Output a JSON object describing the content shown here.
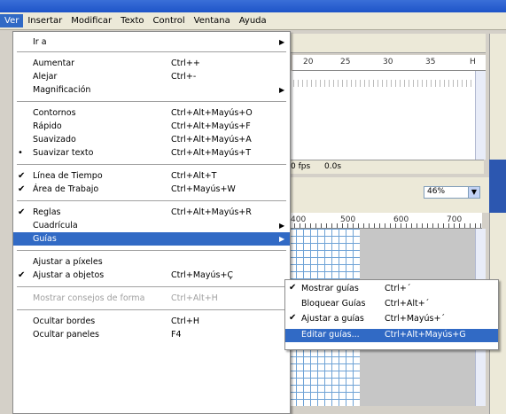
{
  "menubar": {
    "items": [
      "Ver",
      "Insertar",
      "Modificar",
      "Texto",
      "Control",
      "Ventana",
      "Ayuda"
    ]
  },
  "menu": {
    "go_to": {
      "label": "Ir a"
    },
    "zoom_in": {
      "label": "Aumentar",
      "shortcut": "Ctrl++"
    },
    "zoom_out": {
      "label": "Alejar",
      "shortcut": "Ctrl+-"
    },
    "magnification": {
      "label": "Magnificación"
    },
    "outlines": {
      "label": "Contornos",
      "shortcut": "Ctrl+Alt+Mayús+O"
    },
    "fast": {
      "label": "Rápido",
      "shortcut": "Ctrl+Alt+Mayús+F"
    },
    "antialias": {
      "label": "Suavizado",
      "shortcut": "Ctrl+Alt+Mayús+A"
    },
    "antialias_text": {
      "label": "Suavizar texto",
      "shortcut": "Ctrl+Alt+Mayús+T"
    },
    "timeline": {
      "label": "Línea de Tiempo",
      "shortcut": "Ctrl+Alt+T"
    },
    "work_area": {
      "label": "Área de Trabajo",
      "shortcut": "Ctrl+Mayús+W"
    },
    "rulers": {
      "label": "Reglas",
      "shortcut": "Ctrl+Alt+Mayús+R"
    },
    "grid": {
      "label": "Cuadrícula"
    },
    "guides": {
      "label": "Guías"
    },
    "snap_pixels": {
      "label": "Ajustar a píxeles"
    },
    "snap_objects": {
      "label": "Ajustar a objetos",
      "shortcut": "Ctrl+Mayús+Ç"
    },
    "show_shape_hints": {
      "label": "Mostrar consejos de forma",
      "shortcut": "Ctrl+Alt+H"
    },
    "hide_edges": {
      "label": "Ocultar bordes",
      "shortcut": "Ctrl+H"
    },
    "hide_panels": {
      "label": "Ocultar paneles",
      "shortcut": "F4"
    }
  },
  "submenu": {
    "show_guides": {
      "label": "Mostrar guías",
      "shortcut": "Ctrl+´"
    },
    "lock_guides": {
      "label": "Bloquear Guías",
      "shortcut": "Ctrl+Alt+´"
    },
    "snap_guides": {
      "label": "Ajustar a guías",
      "shortcut": "Ctrl+Mayús+´"
    },
    "edit_guides": {
      "label": "Editar guías...",
      "shortcut": "Ctrl+Alt+Mayús+G"
    }
  },
  "background": {
    "ruler_top": [
      "20",
      "25",
      "30",
      "35",
      "H"
    ],
    "fps": "0 fps",
    "time": "0.0s",
    "zoom": "46%",
    "stage_ruler": [
      "400",
      "500",
      "600",
      "700"
    ]
  },
  "colors": {
    "highlight": "#316ac5",
    "menubar_bg": "#ece9d8",
    "grid_line": "#6fa3d6"
  }
}
